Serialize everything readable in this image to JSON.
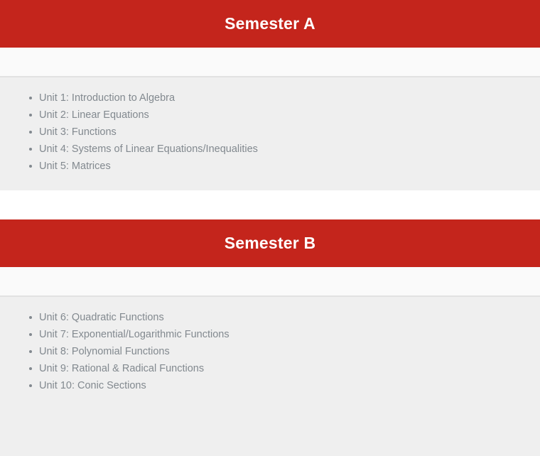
{
  "theme": {
    "header_red": "#c4251c",
    "header_text": "#ffffff",
    "subbar": "#fafafa",
    "body_gray": "#efefef",
    "list_text": "#82898f",
    "divider": "#e2e2e2"
  },
  "sections": [
    {
      "title": "Semester A",
      "units": [
        "Unit 1: Introduction to Algebra",
        "Unit 2: Linear Equations",
        "Unit 3: Functions",
        "Unit 4: Systems of Linear Equations/Inequalities",
        "Unit 5: Matrices"
      ]
    },
    {
      "title": "Semester B",
      "units": [
        "Unit 6: Quadratic Functions",
        "Unit 7: Exponential/Logarithmic Functions",
        "Unit 8: Polynomial Functions",
        "Unit 9: Rational & Radical Functions",
        "Unit 10: Conic Sections"
      ]
    }
  ]
}
